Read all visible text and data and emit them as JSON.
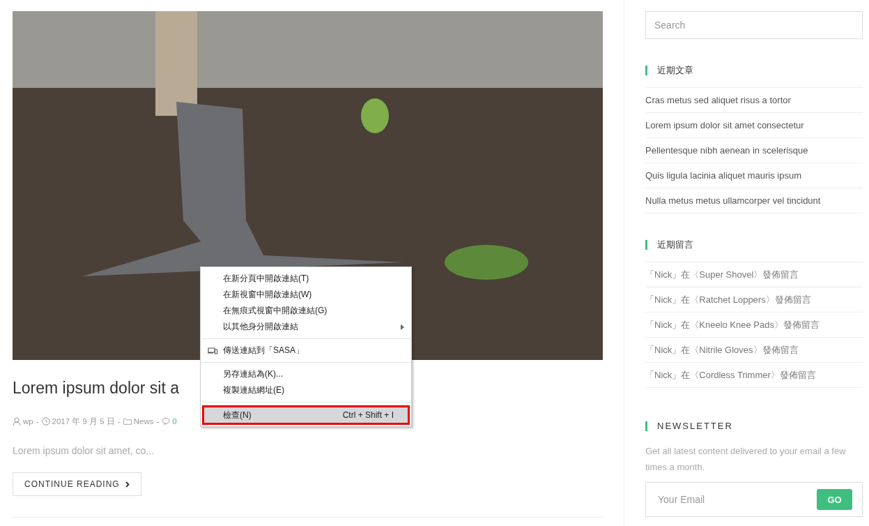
{
  "post": {
    "title": "Lorem ipsum dolor sit a",
    "meta": {
      "author": "wp",
      "date": "2017 年 9 月 5 日",
      "category": "News",
      "comments": "0",
      "separator": "-"
    },
    "excerpt": "Lorem ipsum dolor sit amet, co...",
    "button": "CONTINUE READING"
  },
  "context_menu": {
    "items": [
      {
        "kind": "item",
        "label": "在新分頁中開啟連結(T)",
        "selected": false
      },
      {
        "kind": "item",
        "label": "在新視窗中開啟連結(W)",
        "selected": false
      },
      {
        "kind": "item",
        "label": "在無痕式視窗中開啟連結(G)",
        "selected": false
      },
      {
        "kind": "submenu",
        "label": "以其他身分開啟連結",
        "selected": false
      },
      {
        "kind": "separator"
      },
      {
        "kind": "device",
        "label": "傳送連結到「SASA」",
        "selected": false
      },
      {
        "kind": "separator"
      },
      {
        "kind": "item",
        "label": "另存連結為(K)...",
        "selected": false
      },
      {
        "kind": "item",
        "label": "複製連結網址(E)",
        "selected": false
      },
      {
        "kind": "separator"
      },
      {
        "kind": "item",
        "label": "檢查(N)",
        "shortcut": "Ctrl + Shift + I",
        "selected": true
      }
    ]
  },
  "sidebar": {
    "search": {
      "placeholder": "Search"
    },
    "recent_posts": {
      "title": "近期文章",
      "items": [
        "Cras metus sed aliquet risus a tortor",
        "Lorem ipsum dolor sit amet consectetur",
        "Pellentesque nibh aenean in scelerisque",
        "Quis ligula lacinia aliquet mauris ipsum",
        "Nulla metus metus ullamcorper vel tincidunt"
      ]
    },
    "recent_comments": {
      "title": "近期留言",
      "items": [
        "「Nick」在〈Super Shovel〉發佈留言",
        "「Nick」在〈Ratchet Loppers〉發佈留言",
        "「Nick」在〈Kneelo Knee Pads〉發佈留言",
        "「Nick」在〈Nitrile Gloves〉發佈留言",
        "「Nick」在〈Cordless Trimmer〉發佈留言"
      ]
    },
    "newsletter": {
      "title": "NEWSLETTER",
      "text": "Get all latest content delivered to your email a few times a month.",
      "placeholder": "Your Email",
      "button": "GO"
    }
  }
}
